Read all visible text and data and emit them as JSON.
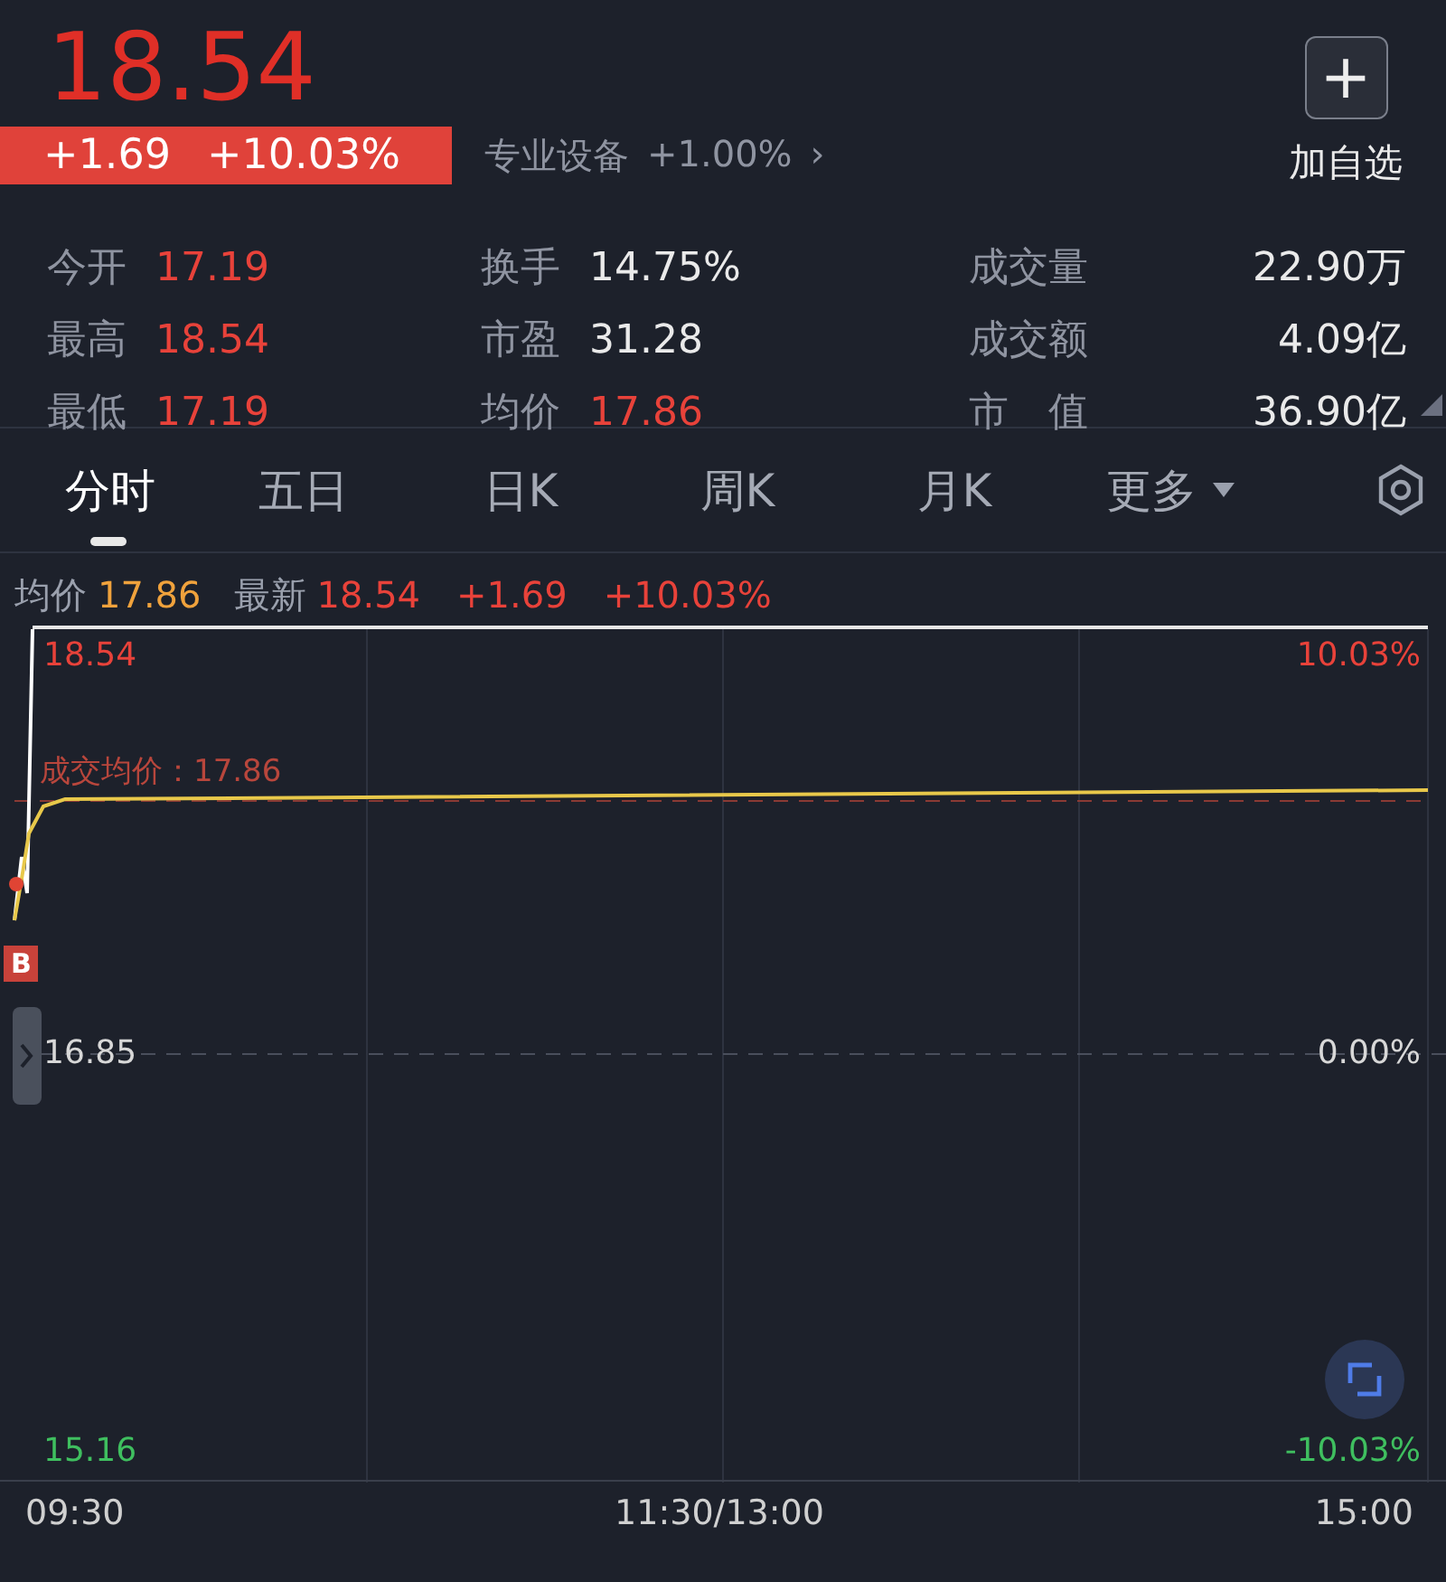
{
  "quote": {
    "price": "18.54",
    "change": "+1.69",
    "change_pct": "+10.03%",
    "sector": "专业设备",
    "sector_change": "+1.00%",
    "sector_arrow": "›",
    "add_watch_icon": "+",
    "add_watch": "加自选"
  },
  "stats": [
    [
      {
        "label": "今开",
        "value": "17.19",
        "color": "#e8423a"
      },
      {
        "label": "换手",
        "value": "14.75%",
        "color": "#eaeaea"
      },
      {
        "label": "成交量",
        "value": "22.90万",
        "color": "#eaeaea"
      }
    ],
    [
      {
        "label": "最高",
        "value": "18.54",
        "color": "#e8423a"
      },
      {
        "label": "市盈",
        "value": "31.28",
        "color": "#eaeaea"
      },
      {
        "label": "成交额",
        "value": "4.09亿",
        "color": "#eaeaea"
      }
    ],
    [
      {
        "label": "最低",
        "value": "17.19",
        "color": "#e8423a"
      },
      {
        "label": "均价",
        "value": "17.86",
        "color": "#e8423a"
      },
      {
        "label": "市　值",
        "value": "36.90亿",
        "color": "#eaeaea"
      }
    ]
  ],
  "tabs": [
    {
      "label": "分时",
      "selected": true
    },
    {
      "label": "五日",
      "selected": false
    },
    {
      "label": "日K",
      "selected": false
    },
    {
      "label": "周K",
      "selected": false
    },
    {
      "label": "月K",
      "selected": false
    },
    {
      "label": "更多",
      "selected": false,
      "dropdown": true
    }
  ],
  "info": {
    "avg_label": "均价",
    "avg": "17.86",
    "last_label": "最新",
    "last": "18.54",
    "change": "+1.69",
    "change_pct": "+10.03%"
  },
  "chart": {
    "y_labels": [
      {
        "label": "18.54",
        "color": "#e8423a"
      },
      {
        "label": "16.85",
        "color": "#d8d8d8"
      },
      {
        "label": "15.16",
        "color": "#3fbf5f"
      }
    ],
    "right_labels": [
      {
        "label": "10.03%",
        "color": "#e8423a"
      },
      {
        "label": "0.00%",
        "color": "#d8d8d8"
      },
      {
        "label": "-10.03%",
        "color": "#3fbf5f"
      }
    ],
    "avg_line_label": "成交均价：17.86",
    "buy_marker": "B",
    "time_labels": [
      "09:30",
      "11:30/13:00",
      "15:00"
    ]
  }
}
